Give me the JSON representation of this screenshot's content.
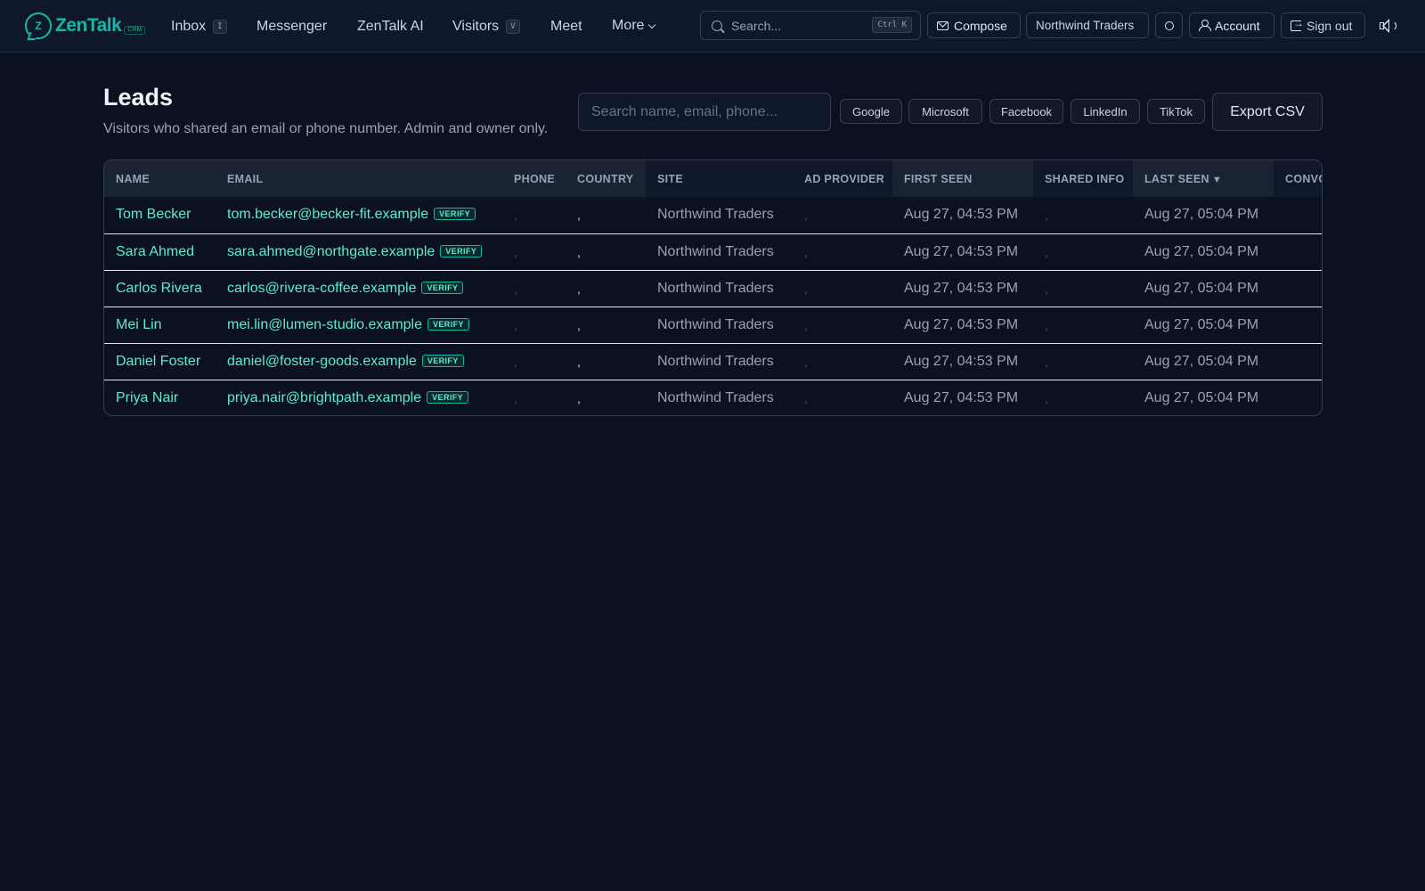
{
  "app": {
    "logo_text": "ZenTalk",
    "logo_sub": "CRM",
    "logo_glyph": "Z"
  },
  "nav": {
    "inbox": {
      "label": "Inbox",
      "kbd": "I"
    },
    "messenger": {
      "label": "Messenger"
    },
    "ai": {
      "label": "ZenTalk AI"
    },
    "visitors": {
      "label": "Visitors",
      "kbd": "V"
    },
    "meet": {
      "label": "Meet"
    },
    "more": {
      "label": "More"
    }
  },
  "search": {
    "placeholder": "Search...",
    "shortcut": "Ctrl K"
  },
  "toolbar": {
    "compose_label": "Compose",
    "workspace_label": "Northwind Traders",
    "account_label": "Account",
    "signout_label": "Sign out"
  },
  "page": {
    "title": "Leads",
    "subtitle": "Visitors who shared an email or phone number. Admin and owner only.",
    "search_placeholder": "Search name, email, phone...",
    "filters": [
      "Google",
      "Microsoft",
      "Facebook",
      "LinkedIn",
      "TikTok"
    ],
    "export_label": "Export CSV"
  },
  "table": {
    "columns": [
      "NAME",
      "EMAIL",
      "PHONE",
      "COUNTRY",
      "SITE",
      "AD PROVIDER",
      "FIRST SEEN",
      "SHARED INFO",
      "LAST SEEN",
      "CONVO"
    ],
    "sort_indicator": "▼",
    "verify_label": "VERIFY",
    "rows": [
      {
        "name": "Tom Becker",
        "email": "tom.becker@becker-fit.example",
        "phone": ",",
        "country": ",",
        "site": "Northwind Traders",
        "ad_provider": ",",
        "first_seen": "Aug 27, 04:53 PM",
        "shared_info": ",",
        "last_seen": "Aug 27, 05:04 PM"
      },
      {
        "name": "Sara Ahmed",
        "email": "sara.ahmed@northgate.example",
        "phone": ",",
        "country": ",",
        "site": "Northwind Traders",
        "ad_provider": ",",
        "first_seen": "Aug 27, 04:53 PM",
        "shared_info": ",",
        "last_seen": "Aug 27, 05:04 PM"
      },
      {
        "name": "Carlos Rivera",
        "email": "carlos@rivera-coffee.example",
        "phone": ",",
        "country": ",",
        "site": "Northwind Traders",
        "ad_provider": ",",
        "first_seen": "Aug 27, 04:53 PM",
        "shared_info": ",",
        "last_seen": "Aug 27, 05:04 PM"
      },
      {
        "name": "Mei Lin",
        "email": "mei.lin@lumen-studio.example",
        "phone": ",",
        "country": ",",
        "site": "Northwind Traders",
        "ad_provider": ",",
        "first_seen": "Aug 27, 04:53 PM",
        "shared_info": ",",
        "last_seen": "Aug 27, 05:04 PM"
      },
      {
        "name": "Daniel Foster",
        "email": "daniel@foster-goods.example",
        "phone": ",",
        "country": ",",
        "site": "Northwind Traders",
        "ad_provider": ",",
        "first_seen": "Aug 27, 04:53 PM",
        "shared_info": ",",
        "last_seen": "Aug 27, 05:04 PM"
      },
      {
        "name": "Priya Nair",
        "email": "priya.nair@brightpath.example",
        "phone": ",",
        "country": ",",
        "site": "Northwind Traders",
        "ad_provider": ",",
        "first_seen": "Aug 27, 04:53 PM",
        "shared_info": ",",
        "last_seen": "Aug 27, 05:04 PM"
      }
    ]
  },
  "colors": {
    "accent": "#14b8a6",
    "link": "#5eead4",
    "background": "#0b1120",
    "topbar": "#0f172a"
  },
  "icons": [
    "logo-icon",
    "search-icon",
    "envelope-icon",
    "sun-icon",
    "user-icon",
    "sign-out-icon",
    "speaker-icon",
    "chevron-down-icon",
    "sort-desc-icon"
  ]
}
